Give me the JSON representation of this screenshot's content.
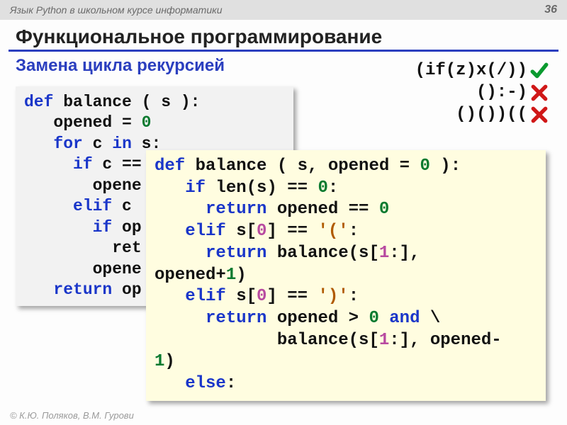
{
  "header": {
    "course": "Язык Python в школьном курсе информатики",
    "page": "36"
  },
  "title": "Функциональное программирование",
  "subtitle": "Замена цикла рекурсией",
  "examples": [
    {
      "text": "(if(z)x(/))",
      "mark": "check"
    },
    {
      "text": "():-)",
      "mark": "cross"
    },
    {
      "text": "()())((",
      "mark": "cross"
    }
  ],
  "code1": {
    "l1a": "def",
    "l1b": " balance ( s ):",
    "l2a": "   opened = ",
    "l2b": "0",
    "l3a": "   ",
    "l3b": "for",
    "l3c": " c ",
    "l3d": "in",
    "l3e": " s:",
    "l4a": "     ",
    "l4b": "if",
    "l4c": " c == ",
    "l4d": "'('",
    "l4e": ":",
    "l5": "       opene",
    "l6a": "     ",
    "l6b": "elif",
    "l6c": " c ",
    "l7a": "       ",
    "l7b": "if",
    "l7c": " op",
    "l8": "         ret",
    "l9": "       opene",
    "l10a": "   ",
    "l10b": "return",
    "l10c": " op"
  },
  "code2": {
    "l1a": "def",
    "l1b": " balance ( s, opened = ",
    "l1c": "0",
    "l1d": " ):",
    "l2a": "   ",
    "l2b": "if",
    "l2c": " len(s) == ",
    "l2d": "0",
    "l2e": ":",
    "l3a": "     ",
    "l3b": "return",
    "l3c": " opened == ",
    "l3d": "0",
    "l4a": "   ",
    "l4b": "elif",
    "l4c": " s[",
    "l4d": "0",
    "l4e": "] == ",
    "l4f": "'('",
    "l4g": ":",
    "l5a": "     ",
    "l5b": "return",
    "l5c": " balance(s[",
    "l5d": "1",
    "l5e": ":], ",
    "l6": "opened+",
    "l6b": "1",
    "l6c": ")",
    "l7a": "   ",
    "l7b": "elif",
    "l7c": " s[",
    "l7d": "0",
    "l7e": "] == ",
    "l7f": "')'",
    "l7g": ":",
    "l8a": "     ",
    "l8b": "return",
    "l8c": " opened > ",
    "l8d": "0",
    "l8e": " ",
    "l8f": "and",
    "l8g": " \\",
    "l9": "            balance(s[",
    "l9b": "1",
    "l9c": ":], opened-",
    "l10a": "1",
    "l10b": ")",
    "l11a": "   ",
    "l11b": "else",
    "l11c": ":"
  },
  "footer": "© К.Ю. Поляков, В.М. Гурови"
}
